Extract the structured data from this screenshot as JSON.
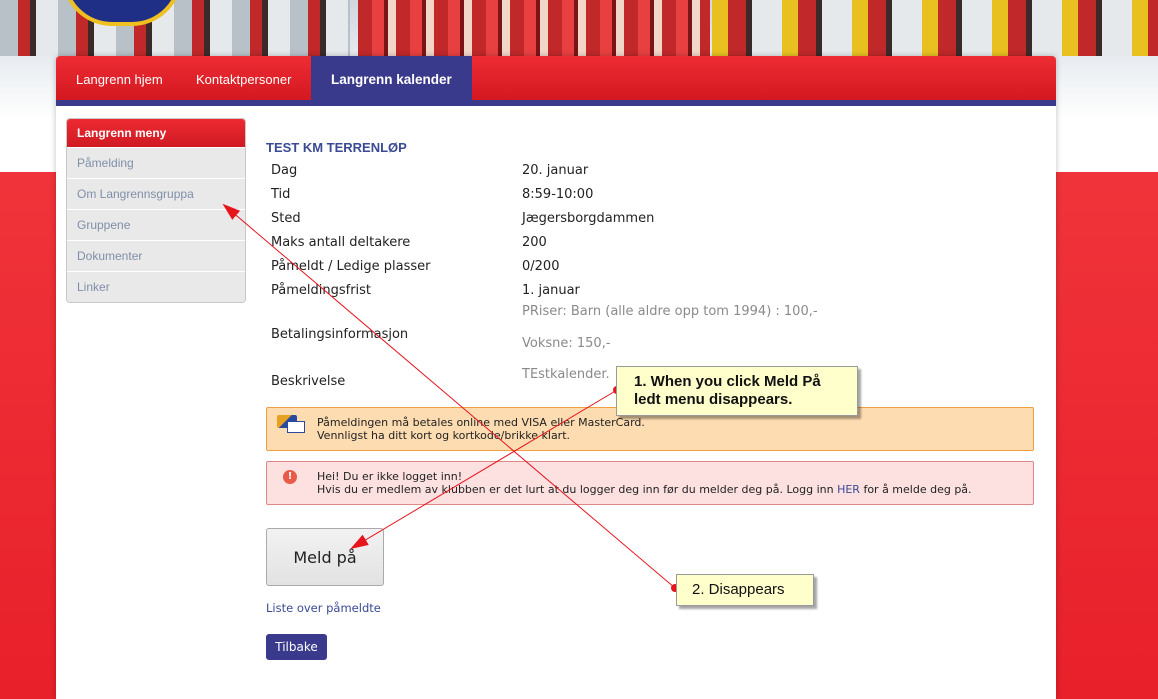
{
  "nav": {
    "items": [
      {
        "label": "Langrenn hjem"
      },
      {
        "label": "Kontaktpersoner"
      },
      {
        "label": "Langrenn kalender",
        "active": true
      }
    ]
  },
  "sidebar": {
    "title": "Langrenn meny",
    "items": [
      {
        "label": "Påmelding"
      },
      {
        "label": "Om Langrennsgruppa"
      },
      {
        "label": "Gruppene"
      },
      {
        "label": "Dokumenter"
      },
      {
        "label": "Linker"
      }
    ]
  },
  "event": {
    "title": "TEST KM TERRENLØP",
    "rows": [
      {
        "label": "Dag",
        "value": "20. januar"
      },
      {
        "label": "Tid",
        "value": "8:59-10:00"
      },
      {
        "label": "Sted",
        "value": "Jægersborgdammen"
      },
      {
        "label": "Maks antall deltakere",
        "value": "200"
      },
      {
        "label": "Påmeldt / Ledige plasser",
        "value": "0/200"
      },
      {
        "label": "Påmeldingsfrist",
        "value": "1. januar"
      }
    ],
    "payment_label": "Betalingsinformasjon",
    "payment_line1": "PRiser: Barn (alle aldre opp tom 1994) : 100,-",
    "payment_line2": "Voksne: 150,-",
    "description_label": "Beskrivelse",
    "description_value": "TEstkalender."
  },
  "notices": {
    "visa_line1": "Påmeldingen må betales online med VISA eller MasterCard.",
    "visa_line2": "Vennligst ha ditt kort og kortkode/brikke klart.",
    "warn_line1": "Hei! Du er ikke logget inn!",
    "warn_line2_before": "Hvis du er medlem av klubben er det lurt at du logger deg inn før du melder deg på. Logg inn",
    "warn_link": "HER",
    "warn_line2_after": "for å melde deg på."
  },
  "actions": {
    "signup_label": "Meld på",
    "list_link": "Liste over påmeldte",
    "back_label": "Tilbake"
  },
  "annotations": {
    "callout1_line1": "1. When you click Meld På",
    "callout1_line2": "ledt menu disappears.",
    "callout2": "2. Disappears",
    "color": "#e8141c"
  }
}
